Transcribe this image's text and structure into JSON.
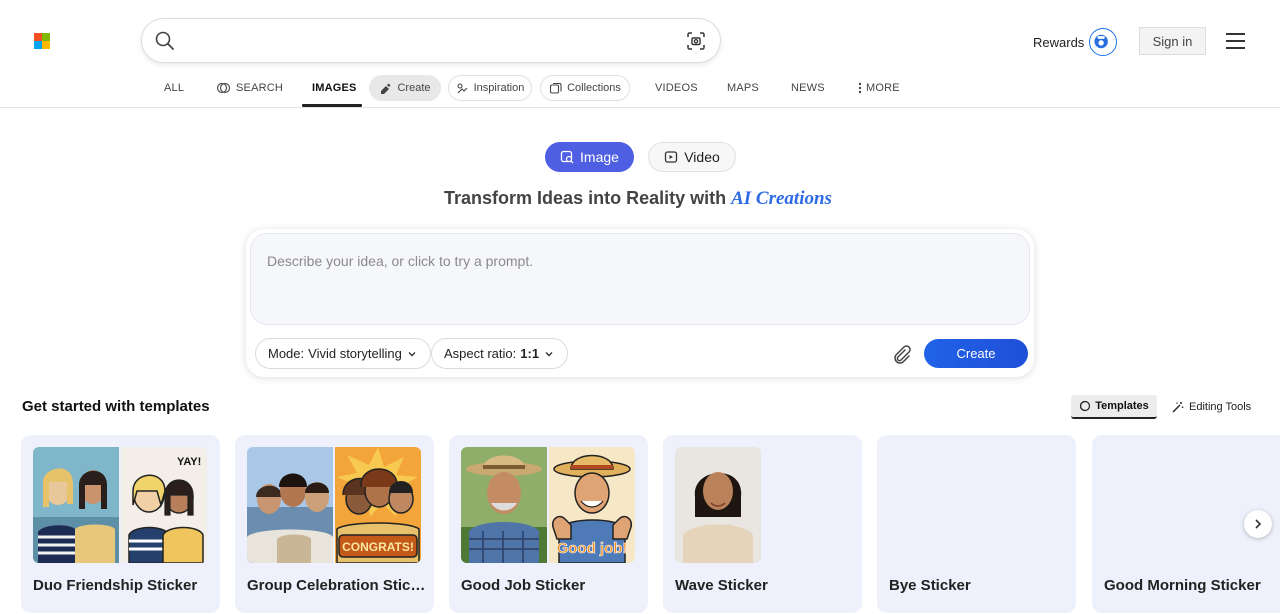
{
  "brand": {
    "logo_colors": [
      "#f25022",
      "#7fba00",
      "#00a4ef",
      "#ffb900"
    ]
  },
  "search": {
    "value": "",
    "placeholder": "",
    "search_icon": "search-icon",
    "visual_search_icon": "visual-search-icon"
  },
  "header": {
    "rewards_label": "Rewards",
    "rewards_icon": "rewards-medal-icon",
    "signin_label": "Sign in",
    "menu_icon": "hamburger-menu-icon"
  },
  "tabs": {
    "all": "ALL",
    "search": "SEARCH",
    "images": "IMAGES",
    "create": "Create",
    "inspiration": "Inspiration",
    "collections": "Collections",
    "videos": "VIDEOS",
    "maps": "MAPS",
    "news": "NEWS",
    "more": "MORE"
  },
  "mode_toggle": {
    "image_label": "Image",
    "video_label": "Video"
  },
  "headline": {
    "prefix": "Transform Ideas into Reality with",
    "highlight": "AI Creations"
  },
  "prompt": {
    "placeholder": "Describe your idea, or click to try a prompt.",
    "mode_label": "Mode:",
    "mode_value": "Vivid storytelling",
    "aspect_label": "Aspect ratio:",
    "aspect_value": "1:1",
    "attach_icon": "paperclip-icon",
    "create_label": "Create"
  },
  "templates_section": {
    "title": "Get started with templates",
    "templates_label": "Templates",
    "editing_label": "Editing Tools"
  },
  "cards": [
    {
      "label": "Duo Friendship Sticker"
    },
    {
      "label": "Group Celebration Sticker"
    },
    {
      "label": "Good Job Sticker"
    },
    {
      "label": "Wave Sticker"
    },
    {
      "label": "Bye Sticker"
    },
    {
      "label": "Good Morning Sticker"
    }
  ],
  "sticker_texts": {
    "yay": "YAY!",
    "congrats": "CONGRATS!",
    "goodjob": "Good job!"
  },
  "colors": {
    "accent": "#4e5fe4",
    "create_button": "#2163e8",
    "ai_text": "#2f6be6",
    "card_bg": "#eef0fb"
  }
}
